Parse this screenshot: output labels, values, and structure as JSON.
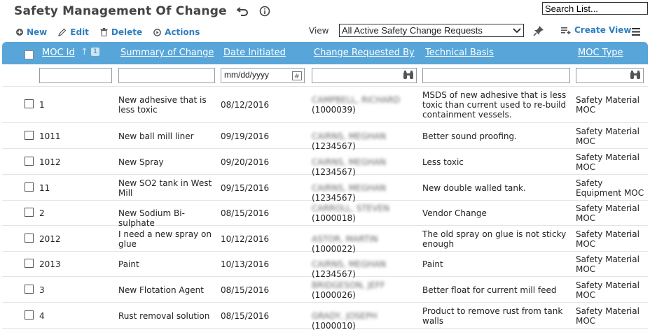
{
  "header": {
    "title": "Safety Management Of Change",
    "search_placeholder": "Search List..."
  },
  "toolbar": {
    "new_label": "New",
    "edit_label": "Edit",
    "delete_label": "Delete",
    "actions_label": "Actions"
  },
  "view": {
    "label": "View",
    "selected": "All Active Safety Change Requests",
    "create_view_label": "Create View"
  },
  "colors": {
    "accent": "#2f7fc0",
    "header_bg": "#58a6d9"
  },
  "columns": {
    "moc_id": "MOC Id",
    "sort_badge": "1",
    "summary": "Summary of Change",
    "date_initiated": "Date Initiated",
    "requested_by": "Change Requested By",
    "technical_basis": "Technical Basis",
    "moc_type": "MOC Type"
  },
  "filters": {
    "date_placeholder": "mm/dd/yyyy"
  },
  "rows": [
    {
      "id": "1",
      "summary": "New adhesive that is less toxic",
      "date": "08/12/2016",
      "requester_name": "CAMPBELL, RICHARD",
      "requester_id": "(1000039)",
      "basis": "MSDS of new adhesive that is less toxic than current used to re-build containment vessels.",
      "type": "Safety Material MOC"
    },
    {
      "id": "1011",
      "summary": "New ball mill liner",
      "date": "09/19/2016",
      "requester_name": "CAIRNS, MEGHAN",
      "requester_id": "(1234567)",
      "basis": "Better sound proofing.",
      "type": "Safety Material MOC"
    },
    {
      "id": "1012",
      "summary": "New Spray",
      "date": "09/20/2016",
      "requester_name": "CAIRNS, MEGHAN",
      "requester_id": "(1234567)",
      "basis": "Less toxic",
      "type": "Safety Material MOC"
    },
    {
      "id": "11",
      "summary": "New SO2 tank in West Mill",
      "date": "09/15/2016",
      "requester_name": "CAIRNS, MEGHAN",
      "requester_id": "(1234567)",
      "basis": "New double walled tank.",
      "type": "Safety Equipment MOC"
    },
    {
      "id": "2",
      "summary": "New Sodium Bi-sulphate",
      "date": "08/15/2016",
      "requester_name": "CARROLL, STEVEN",
      "requester_id": "(1000018)",
      "basis": "Vendor Change",
      "type": "Safety Material MOC"
    },
    {
      "id": "2012",
      "summary": "I need a new spray on glue",
      "date": "10/12/2016",
      "requester_name": "ASTOR, MARTIN",
      "requester_id": "(1000022)",
      "basis": "The old spray on glue is not sticky enough",
      "type": "Safety Material MOC"
    },
    {
      "id": "2013",
      "summary": "Paint",
      "date": "10/13/2016",
      "requester_name": "CAIRNS, MEGHAN",
      "requester_id": "(1234567)",
      "basis": "Paint",
      "type": "Safety Material MOC"
    },
    {
      "id": "3",
      "summary": "New Flotation Agent",
      "date": "08/15/2016",
      "requester_name": "BRIDGESON, JEFF",
      "requester_id": "(1000026)",
      "basis": "Better float for current mill feed",
      "type": "Safety Material MOC"
    },
    {
      "id": "4",
      "summary": "Rust removal solution",
      "date": "08/15/2016",
      "requester_name": "GRADY, JOSEPH",
      "requester_id": "(1000010)",
      "basis": "Product to remove rust from tank walls",
      "type": "Safety Material MOC"
    }
  ]
}
